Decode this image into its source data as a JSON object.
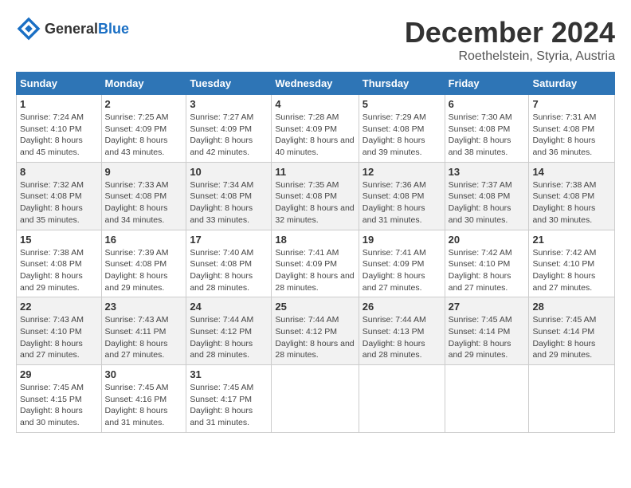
{
  "logo": {
    "general": "General",
    "blue": "Blue"
  },
  "title": "December 2024",
  "subtitle": "Roethelstein, Styria, Austria",
  "headers": [
    "Sunday",
    "Monday",
    "Tuesday",
    "Wednesday",
    "Thursday",
    "Friday",
    "Saturday"
  ],
  "weeks": [
    [
      {
        "day": "1",
        "sunrise": "Sunrise: 7:24 AM",
        "sunset": "Sunset: 4:10 PM",
        "daylight": "Daylight: 8 hours and 45 minutes."
      },
      {
        "day": "2",
        "sunrise": "Sunrise: 7:25 AM",
        "sunset": "Sunset: 4:09 PM",
        "daylight": "Daylight: 8 hours and 43 minutes."
      },
      {
        "day": "3",
        "sunrise": "Sunrise: 7:27 AM",
        "sunset": "Sunset: 4:09 PM",
        "daylight": "Daylight: 8 hours and 42 minutes."
      },
      {
        "day": "4",
        "sunrise": "Sunrise: 7:28 AM",
        "sunset": "Sunset: 4:09 PM",
        "daylight": "Daylight: 8 hours and 40 minutes."
      },
      {
        "day": "5",
        "sunrise": "Sunrise: 7:29 AM",
        "sunset": "Sunset: 4:08 PM",
        "daylight": "Daylight: 8 hours and 39 minutes."
      },
      {
        "day": "6",
        "sunrise": "Sunrise: 7:30 AM",
        "sunset": "Sunset: 4:08 PM",
        "daylight": "Daylight: 8 hours and 38 minutes."
      },
      {
        "day": "7",
        "sunrise": "Sunrise: 7:31 AM",
        "sunset": "Sunset: 4:08 PM",
        "daylight": "Daylight: 8 hours and 36 minutes."
      }
    ],
    [
      {
        "day": "8",
        "sunrise": "Sunrise: 7:32 AM",
        "sunset": "Sunset: 4:08 PM",
        "daylight": "Daylight: 8 hours and 35 minutes."
      },
      {
        "day": "9",
        "sunrise": "Sunrise: 7:33 AM",
        "sunset": "Sunset: 4:08 PM",
        "daylight": "Daylight: 8 hours and 34 minutes."
      },
      {
        "day": "10",
        "sunrise": "Sunrise: 7:34 AM",
        "sunset": "Sunset: 4:08 PM",
        "daylight": "Daylight: 8 hours and 33 minutes."
      },
      {
        "day": "11",
        "sunrise": "Sunrise: 7:35 AM",
        "sunset": "Sunset: 4:08 PM",
        "daylight": "Daylight: 8 hours and 32 minutes."
      },
      {
        "day": "12",
        "sunrise": "Sunrise: 7:36 AM",
        "sunset": "Sunset: 4:08 PM",
        "daylight": "Daylight: 8 hours and 31 minutes."
      },
      {
        "day": "13",
        "sunrise": "Sunrise: 7:37 AM",
        "sunset": "Sunset: 4:08 PM",
        "daylight": "Daylight: 8 hours and 30 minutes."
      },
      {
        "day": "14",
        "sunrise": "Sunrise: 7:38 AM",
        "sunset": "Sunset: 4:08 PM",
        "daylight": "Daylight: 8 hours and 30 minutes."
      }
    ],
    [
      {
        "day": "15",
        "sunrise": "Sunrise: 7:38 AM",
        "sunset": "Sunset: 4:08 PM",
        "daylight": "Daylight: 8 hours and 29 minutes."
      },
      {
        "day": "16",
        "sunrise": "Sunrise: 7:39 AM",
        "sunset": "Sunset: 4:08 PM",
        "daylight": "Daylight: 8 hours and 29 minutes."
      },
      {
        "day": "17",
        "sunrise": "Sunrise: 7:40 AM",
        "sunset": "Sunset: 4:08 PM",
        "daylight": "Daylight: 8 hours and 28 minutes."
      },
      {
        "day": "18",
        "sunrise": "Sunrise: 7:41 AM",
        "sunset": "Sunset: 4:09 PM",
        "daylight": "Daylight: 8 hours and 28 minutes."
      },
      {
        "day": "19",
        "sunrise": "Sunrise: 7:41 AM",
        "sunset": "Sunset: 4:09 PM",
        "daylight": "Daylight: 8 hours and 27 minutes."
      },
      {
        "day": "20",
        "sunrise": "Sunrise: 7:42 AM",
        "sunset": "Sunset: 4:10 PM",
        "daylight": "Daylight: 8 hours and 27 minutes."
      },
      {
        "day": "21",
        "sunrise": "Sunrise: 7:42 AM",
        "sunset": "Sunset: 4:10 PM",
        "daylight": "Daylight: 8 hours and 27 minutes."
      }
    ],
    [
      {
        "day": "22",
        "sunrise": "Sunrise: 7:43 AM",
        "sunset": "Sunset: 4:10 PM",
        "daylight": "Daylight: 8 hours and 27 minutes."
      },
      {
        "day": "23",
        "sunrise": "Sunrise: 7:43 AM",
        "sunset": "Sunset: 4:11 PM",
        "daylight": "Daylight: 8 hours and 27 minutes."
      },
      {
        "day": "24",
        "sunrise": "Sunrise: 7:44 AM",
        "sunset": "Sunset: 4:12 PM",
        "daylight": "Daylight: 8 hours and 28 minutes."
      },
      {
        "day": "25",
        "sunrise": "Sunrise: 7:44 AM",
        "sunset": "Sunset: 4:12 PM",
        "daylight": "Daylight: 8 hours and 28 minutes."
      },
      {
        "day": "26",
        "sunrise": "Sunrise: 7:44 AM",
        "sunset": "Sunset: 4:13 PM",
        "daylight": "Daylight: 8 hours and 28 minutes."
      },
      {
        "day": "27",
        "sunrise": "Sunrise: 7:45 AM",
        "sunset": "Sunset: 4:14 PM",
        "daylight": "Daylight: 8 hours and 29 minutes."
      },
      {
        "day": "28",
        "sunrise": "Sunrise: 7:45 AM",
        "sunset": "Sunset: 4:14 PM",
        "daylight": "Daylight: 8 hours and 29 minutes."
      }
    ],
    [
      {
        "day": "29",
        "sunrise": "Sunrise: 7:45 AM",
        "sunset": "Sunset: 4:15 PM",
        "daylight": "Daylight: 8 hours and 30 minutes."
      },
      {
        "day": "30",
        "sunrise": "Sunrise: 7:45 AM",
        "sunset": "Sunset: 4:16 PM",
        "daylight": "Daylight: 8 hours and 31 minutes."
      },
      {
        "day": "31",
        "sunrise": "Sunrise: 7:45 AM",
        "sunset": "Sunset: 4:17 PM",
        "daylight": "Daylight: 8 hours and 31 minutes."
      },
      null,
      null,
      null,
      null
    ]
  ]
}
